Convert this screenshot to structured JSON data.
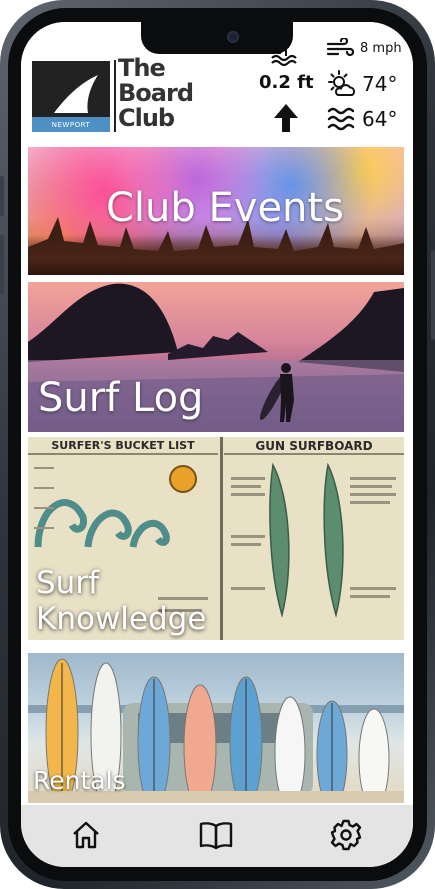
{
  "header": {
    "logo": {
      "line1": "The",
      "line2": "Board",
      "line3": "Club",
      "badge": "NEWPORT"
    },
    "tide": {
      "icon": "tide-water-icon",
      "value": "0.2 ft",
      "trend_icon": "arrow-up-icon"
    },
    "weather": {
      "wind": {
        "icon": "wind-icon",
        "value": "8 mph"
      },
      "air": {
        "icon": "sun-cloud-icon",
        "value": "74°"
      },
      "water": {
        "icon": "waves-icon",
        "value": "64°"
      }
    }
  },
  "tiles": [
    {
      "label": "Club Events",
      "image": "color-festival-crowd"
    },
    {
      "label": "Surf Log",
      "image": "surfer-sunset-silhouette"
    },
    {
      "label": "Surf Knowledge",
      "image": "surf-poster",
      "poster": {
        "left_title": "SURFER'S BUCKET LIST",
        "right_title": "GUN SURFBOARD"
      }
    },
    {
      "label": "Rentals",
      "image": "surfboards-on-beach"
    }
  ],
  "nav": [
    {
      "icon": "home-icon"
    },
    {
      "icon": "book-icon"
    },
    {
      "icon": "gear-icon"
    }
  ],
  "colors": {
    "nav_bg": "#e4e4e4",
    "text_dark": "#111111",
    "logo_dark": "#222222"
  }
}
